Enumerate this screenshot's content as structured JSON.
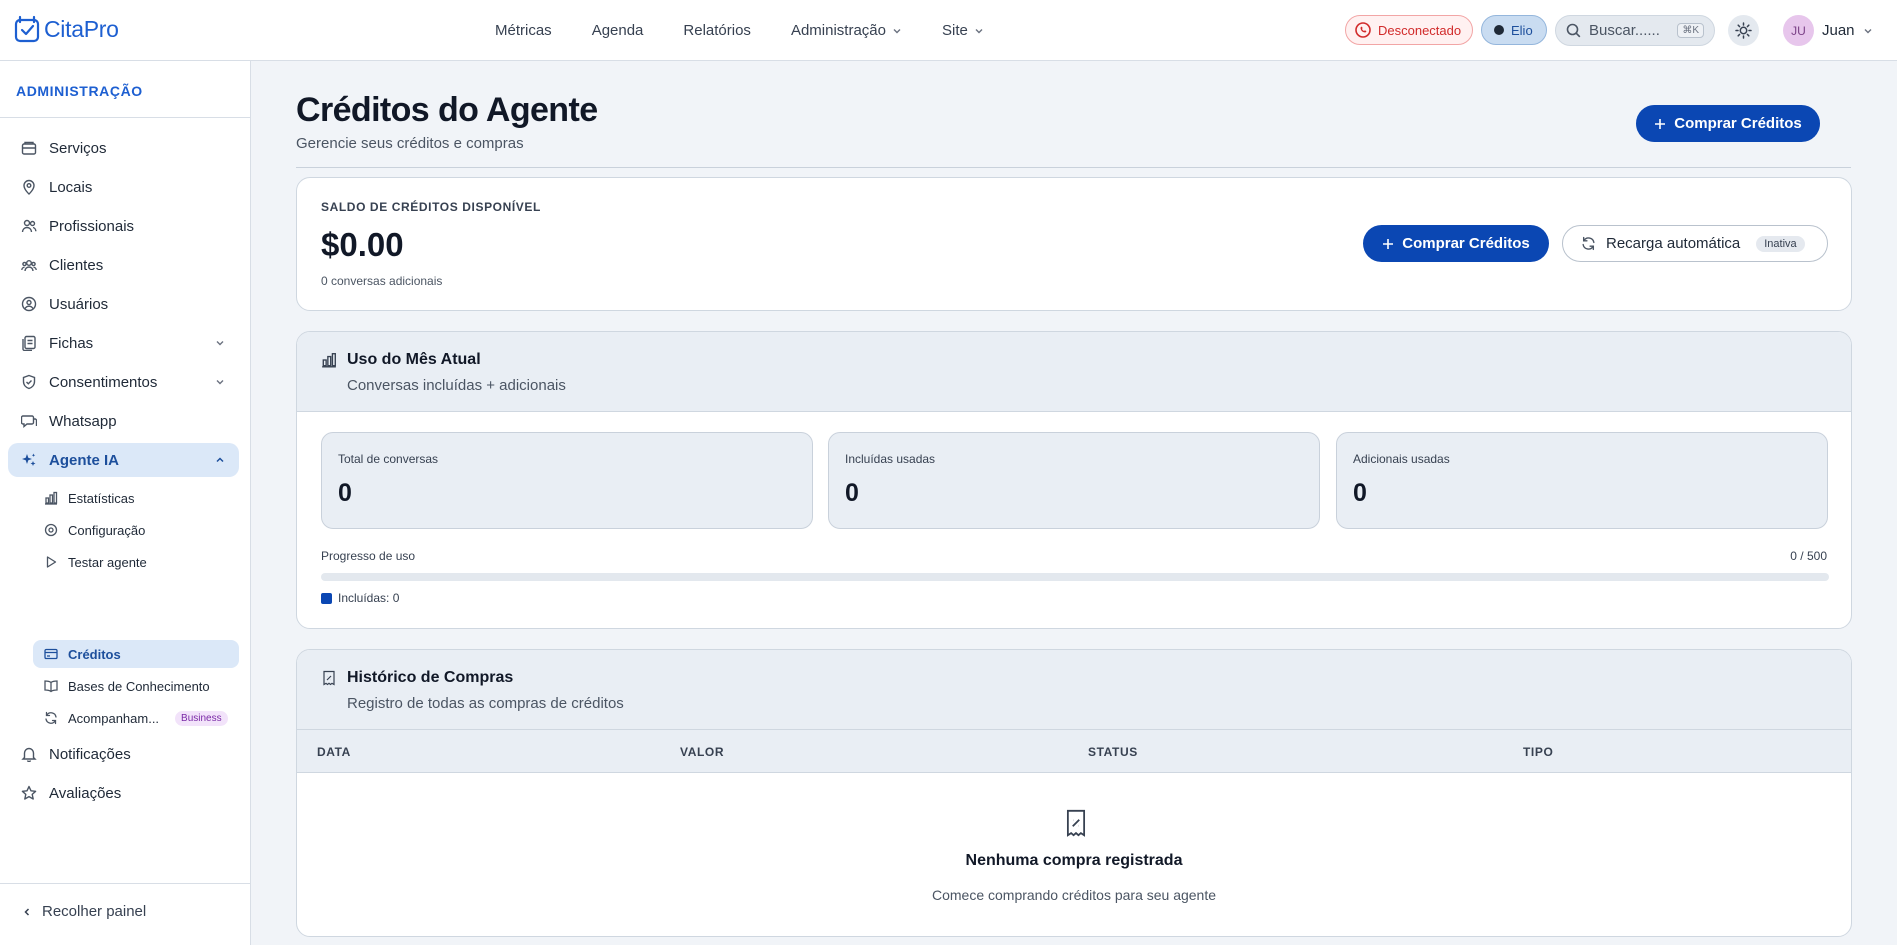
{
  "app": {
    "brand": "CitaPro",
    "brand_color": "#1d5fd1",
    "accent": "#0b47b3"
  },
  "nav": [
    {
      "label": "Métricas",
      "dropdown": false
    },
    {
      "label": "Agenda",
      "dropdown": false
    },
    {
      "label": "Relatórios",
      "dropdown": false
    },
    {
      "label": "Administração",
      "dropdown": true
    },
    {
      "label": "Site",
      "dropdown": true
    }
  ],
  "topbar": {
    "whatsapp_status": "Desconectado",
    "agent_pill": "Elio",
    "search_placeholder": "Buscar......",
    "search_shortcut": "⌘K",
    "theme_icon": "sun-icon",
    "user_initials": "JU",
    "user_name": "Juan"
  },
  "sidebar": {
    "title": "ADMINISTRAÇÃO",
    "items": [
      {
        "label": "Serviços",
        "icon": "box-icon"
      },
      {
        "label": "Locais",
        "icon": "map-pin-icon"
      },
      {
        "label": "Profissionais",
        "icon": "users-icon"
      },
      {
        "label": "Clientes",
        "icon": "user-group-icon"
      },
      {
        "label": "Usuários",
        "icon": "user-circle-icon"
      },
      {
        "label": "Fichas",
        "icon": "files-icon",
        "expandable": true
      },
      {
        "label": "Consentimentos",
        "icon": "shield-check-icon",
        "expandable": true
      },
      {
        "label": "Whatsapp",
        "icon": "chat-icon"
      },
      {
        "label": "Agente IA",
        "icon": "sparkles-icon",
        "expanded": true,
        "active": true
      },
      {
        "label": "Notificações",
        "icon": "bell-icon"
      },
      {
        "label": "Avaliações",
        "icon": "star-icon"
      }
    ],
    "subitems": [
      {
        "label": "Estatísticas",
        "icon": "bar-chart-icon"
      },
      {
        "label": "Configuração",
        "icon": "gear-icon"
      },
      {
        "label": "Testar agente",
        "icon": "play-icon"
      },
      {
        "label": "Créditos",
        "icon": "credit-card-icon",
        "active": true
      },
      {
        "label": "Bases de Conhecimento",
        "icon": "book-icon"
      },
      {
        "label": "Acompanham...",
        "icon": "refresh-icon",
        "badge": "Business"
      }
    ],
    "collapse_label": "Recolher painel"
  },
  "page": {
    "title": "Créditos do Agente",
    "subtitle": "Gerencie seus créditos e compras",
    "buy_button": "Comprar Créditos"
  },
  "balance": {
    "label": "SALDO DE CRÉDITOS DISPONÍVEL",
    "value": "$0.00",
    "note": "0 conversas adicionais",
    "buy_button": "Comprar Créditos",
    "recharge_label": "Recarga automática",
    "recharge_status": "Inativa"
  },
  "usage": {
    "title": "Uso do Mês Atual",
    "subtitle": "Conversas incluídas + adicionais",
    "stats": [
      {
        "label": "Total de conversas",
        "value": "0"
      },
      {
        "label": "Incluídas usadas",
        "value": "0"
      },
      {
        "label": "Adicionais usadas",
        "value": "0"
      }
    ],
    "progress_label": "Progresso de uso",
    "progress_count": "0 / 500",
    "progress_fraction": 0,
    "legend_included": "Incluídas: 0"
  },
  "history": {
    "title": "Histórico de Compras",
    "subtitle": "Registro de todas as compras de créditos",
    "columns": [
      "DATA",
      "VALOR",
      "STATUS",
      "TIPO"
    ],
    "rows": [],
    "empty_title": "Nenhuma compra registrada",
    "empty_subtitle": "Comece comprando créditos para seu agente"
  }
}
